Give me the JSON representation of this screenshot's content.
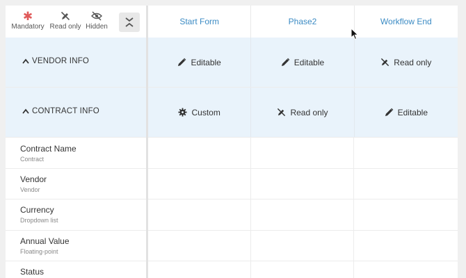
{
  "legend": {
    "mandatory": "Mandatory",
    "read_only": "Read only",
    "hidden": "Hidden"
  },
  "columns": [
    "Start Form",
    "Phase2",
    "Workflow End"
  ],
  "sections": [
    {
      "title": "VENDOR INFO",
      "cells": [
        {
          "icon": "pencil-icon",
          "label": "Editable"
        },
        {
          "icon": "pencil-icon",
          "label": "Editable"
        },
        {
          "icon": "read-only-pencil-icon",
          "label": "Read only"
        }
      ]
    },
    {
      "title": "CONTRACT INFO",
      "cells": [
        {
          "icon": "gear-icon",
          "label": "Custom"
        },
        {
          "icon": "read-only-pencil-icon",
          "label": "Read only"
        },
        {
          "icon": "pencil-icon",
          "label": "Editable"
        }
      ]
    }
  ],
  "fields": [
    {
      "name": "Contract Name",
      "type": "Contract"
    },
    {
      "name": "Vendor",
      "type": "Vendor"
    },
    {
      "name": "Currency",
      "type": "Dropdown list"
    },
    {
      "name": "Annual Value",
      "type": "Floating-point"
    },
    {
      "name": "Status",
      "type": ""
    }
  ],
  "colors": {
    "accent": "#3b8bc4",
    "section_bg": "#e9f3fb",
    "mandatory_star": "#e05a5a"
  }
}
